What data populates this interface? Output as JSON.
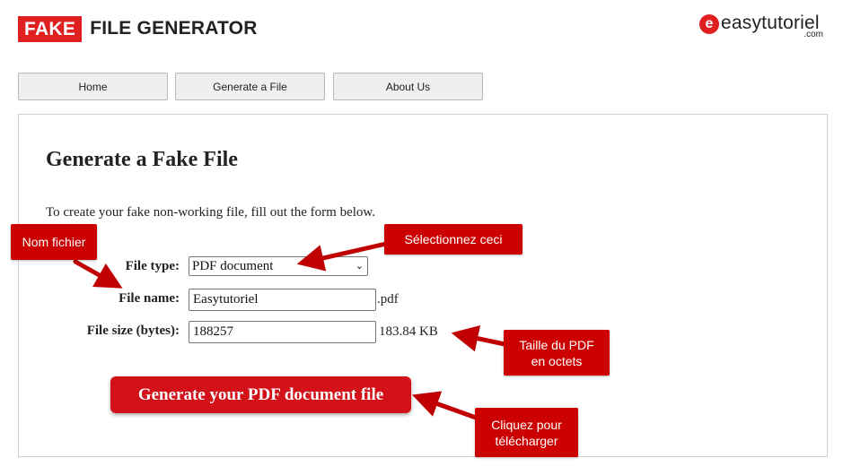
{
  "header": {
    "logo_fake": "FAKE",
    "logo_rest": "FILE GENERATOR",
    "brand_mark": "e",
    "brand_name": "easytutoriel",
    "brand_tld": ".com"
  },
  "nav": {
    "items": [
      {
        "label": "Home"
      },
      {
        "label": "Generate a File"
      },
      {
        "label": "About Us"
      }
    ]
  },
  "main": {
    "title": "Generate a Fake File",
    "intro": "To create your fake non-working file, fill out the form below.",
    "form": {
      "file_type_label": "File type:",
      "file_type_value": "PDF document",
      "file_name_label": "File name:",
      "file_name_value": "Easytutoriel",
      "file_name_suffix": ".pdf",
      "file_size_label": "File size (bytes):",
      "file_size_value": "188257",
      "file_size_human": "183.84 KB",
      "generate_label": "Generate your PDF document file"
    }
  },
  "annotations": {
    "nom_fichier": "Nom fichier",
    "selectionnez": "Sélectionnez ceci",
    "taille": "Taille du PDF\nen octets",
    "cliquez": "Cliquez pour\ntélécharger"
  },
  "colors": {
    "accent_red": "#d21118",
    "callout_red": "#cc0000"
  }
}
